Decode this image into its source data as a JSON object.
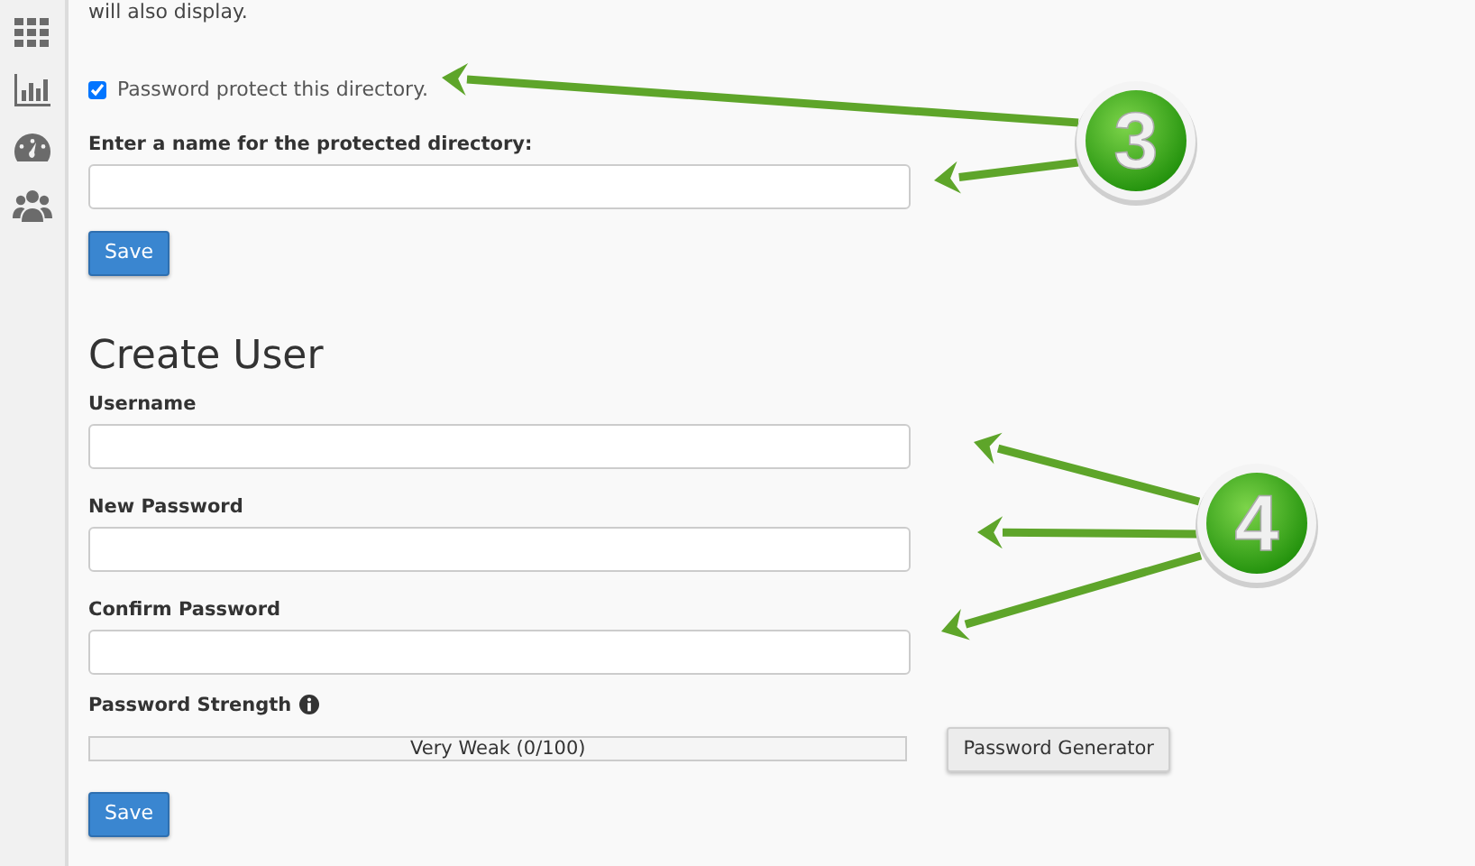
{
  "intro_text": "will also display.",
  "protect": {
    "label": "Password protect this directory.",
    "checked": true
  },
  "directory_name": {
    "label": "Enter a name for the protected directory:"
  },
  "save_button_1": "Save",
  "create_user": {
    "heading": "Create User",
    "fields": [
      {
        "label": "Username"
      },
      {
        "label": "New Password"
      },
      {
        "label": "Confirm Password"
      }
    ],
    "strength": {
      "label": "Password Strength",
      "level": 0,
      "reading": "Very Weak (0/100)"
    },
    "generator_button": "Password Generator",
    "save_button": "Save"
  },
  "annotations": [
    {
      "number": "3"
    },
    {
      "number": "4"
    }
  ]
}
